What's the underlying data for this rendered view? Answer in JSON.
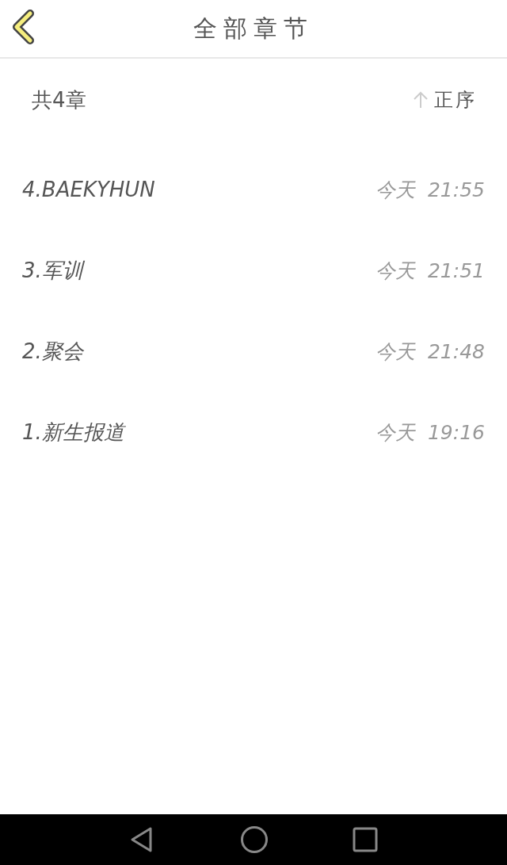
{
  "header": {
    "title": "全部章节"
  },
  "summary": {
    "count": "共4章",
    "sort_label": "正序"
  },
  "chapters": [
    {
      "title": "4.BAEKYHUN",
      "day": "今天",
      "time": "21:55"
    },
    {
      "title": "3.军训",
      "day": "今天",
      "time": "21:51"
    },
    {
      "title": "2.聚会",
      "day": "今天",
      "time": "21:48"
    },
    {
      "title": "1.新生报道",
      "day": "今天",
      "time": "19:16"
    }
  ]
}
